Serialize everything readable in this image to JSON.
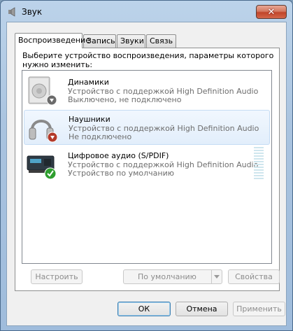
{
  "window": {
    "title": "Звук",
    "close_glyph": "✕"
  },
  "tabs": [
    {
      "label": "Воспроизведение",
      "active": true
    },
    {
      "label": "Запись",
      "active": false
    },
    {
      "label": "Звуки",
      "active": false
    },
    {
      "label": "Связь",
      "active": false
    }
  ],
  "panel": {
    "instruction": "Выберите устройство воспроизведения, параметры которого нужно изменить:"
  },
  "devices": [
    {
      "name": "Динамики",
      "description": "Устройство с поддержкой High Definition Audio",
      "status": "Выключено, не подключено",
      "icon": "speakers-icon",
      "badge": "down-arrow-badge",
      "selected": false
    },
    {
      "name": "Наушники",
      "description": "Устройство с поддержкой High Definition Audio",
      "status": "Не подключено",
      "icon": "headphones-icon",
      "badge": "down-arrow-red-badge",
      "selected": true
    },
    {
      "name": "Цифровое аудио (S/PDIF)",
      "description": "Устройство с поддержкой High Definition Audio",
      "status": "Устройство по умолчанию",
      "icon": "digital-audio-icon",
      "badge": "checkmark-badge",
      "selected": false
    }
  ],
  "panel_buttons": {
    "configure": "Настроить",
    "set_default": "По умолчанию",
    "properties": "Свойства"
  },
  "dialog_buttons": {
    "ok": "ОК",
    "cancel": "Отмена",
    "apply": "Применить"
  },
  "colors": {
    "accent": "#3c7fb1",
    "selection": "#e2eefb",
    "disabled_text": "#8d8d8d"
  }
}
